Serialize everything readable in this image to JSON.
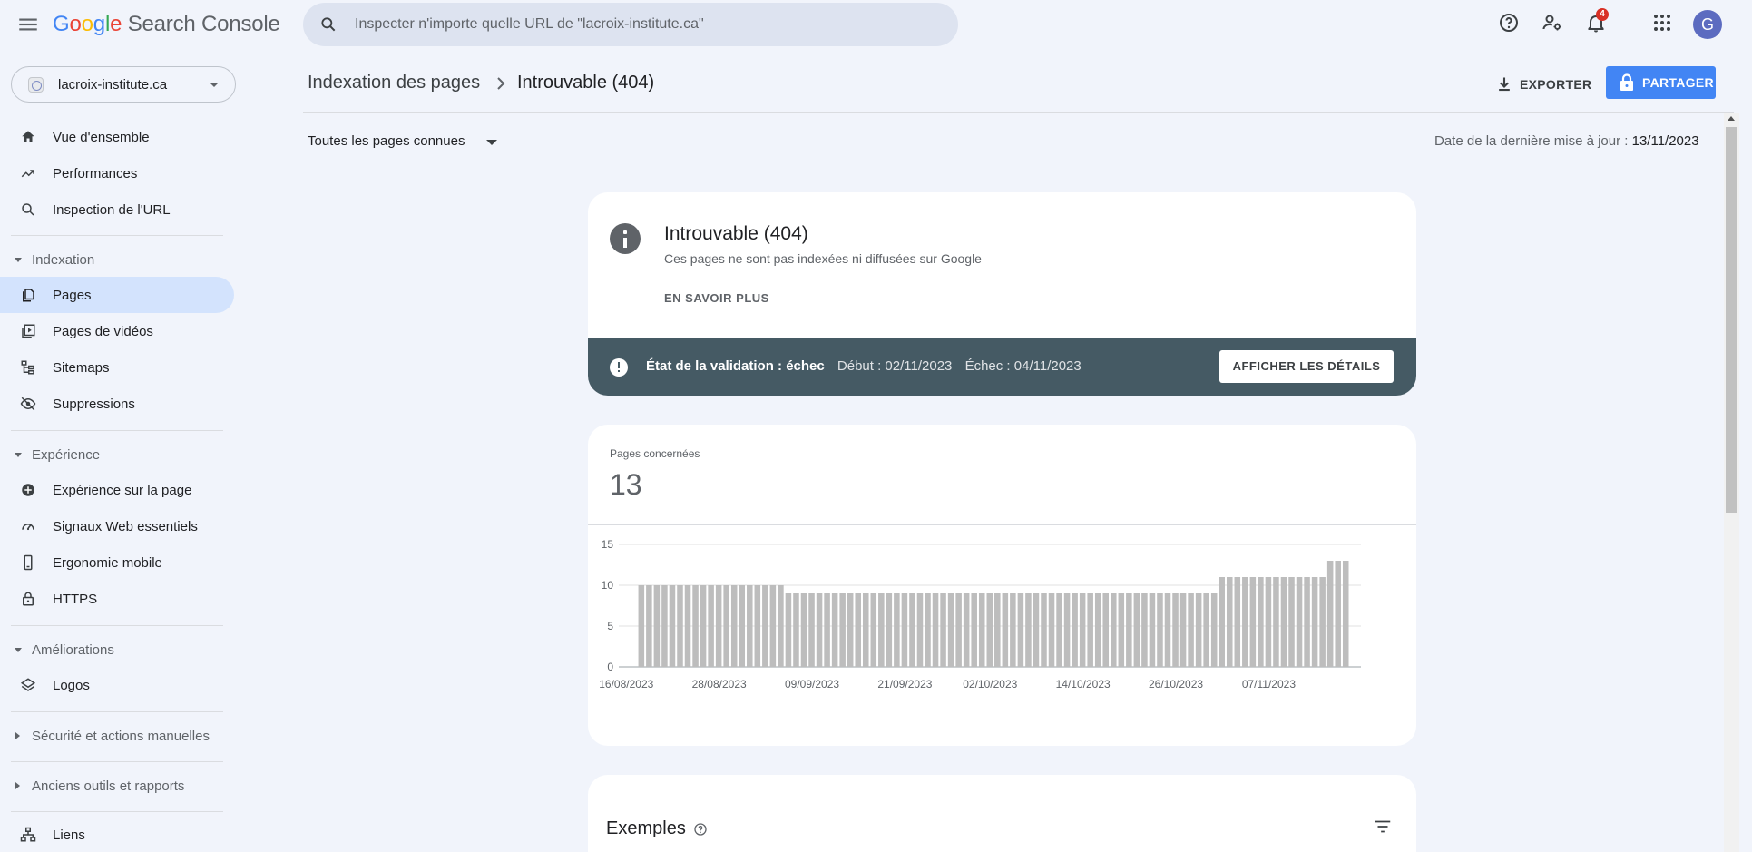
{
  "app": {
    "logo_google": [
      "G",
      "o",
      "o",
      "g",
      "l",
      "e"
    ],
    "logo_rest": "Search Console"
  },
  "search": {
    "placeholder": "Inspecter n'importe quelle URL de \"lacroix-institute.ca\""
  },
  "header": {
    "notification_count": "4",
    "avatar_letter": "G"
  },
  "property": {
    "label": "lacroix-institute.ca"
  },
  "sidebar": {
    "top_items": [
      {
        "label": "Vue d'ensemble",
        "icon": "home-icon"
      },
      {
        "label": "Performances",
        "icon": "trending-up-icon"
      },
      {
        "label": "Inspection de l'URL",
        "icon": "search-icon"
      }
    ],
    "sections": [
      {
        "label": "Indexation",
        "expanded": true,
        "items": [
          {
            "label": "Pages",
            "icon": "pages-icon",
            "active": true
          },
          {
            "label": "Pages de vidéos",
            "icon": "video-pages-icon"
          },
          {
            "label": "Sitemaps",
            "icon": "sitemap-icon"
          },
          {
            "label": "Suppressions",
            "icon": "eye-off-icon"
          }
        ]
      },
      {
        "label": "Expérience",
        "expanded": true,
        "items": [
          {
            "label": "Expérience sur la page",
            "icon": "plus-circle-icon"
          },
          {
            "label": "Signaux Web essentiels",
            "icon": "speed-gauge-icon"
          },
          {
            "label": "Ergonomie mobile",
            "icon": "phone-icon"
          },
          {
            "label": "HTTPS",
            "icon": "lock-icon"
          }
        ]
      },
      {
        "label": "Améliorations",
        "expanded": true,
        "items": [
          {
            "label": "Logos",
            "icon": "layers-icon"
          }
        ]
      },
      {
        "label": "Sécurité et actions manuelles",
        "expanded": false,
        "items": []
      },
      {
        "label": "Anciens outils et rapports",
        "expanded": false,
        "items": []
      }
    ],
    "bottom_items": [
      {
        "label": "Liens",
        "icon": "links-icon"
      }
    ]
  },
  "breadcrumb": {
    "parent": "Indexation des pages",
    "current": "Introuvable (404)"
  },
  "toolbar": {
    "export_label": "EXPORTER",
    "share_label": "PARTAGER"
  },
  "filter": {
    "selected": "Toutes les pages connues"
  },
  "last_update": {
    "prefix": "Date de la dernière mise à jour :",
    "date": "13/11/2023"
  },
  "issue_card": {
    "title": "Introuvable (404)",
    "description": "Ces pages ne sont pas indexées ni diffusées sur Google",
    "learn_more": "EN SAVOIR PLUS",
    "validation_status": "État de la validation : échec",
    "start": "Début : 02/11/2023",
    "failed": "Échec : 04/11/2023",
    "details_button": "AFFICHER LES DÉTAILS"
  },
  "kpi": {
    "label": "Pages concernées",
    "value": "13"
  },
  "chart_data": {
    "type": "bar",
    "ylim": [
      0,
      15
    ],
    "yticks": [
      0,
      5,
      10,
      15
    ],
    "xtick_labels": [
      "16/08/2023",
      "28/08/2023",
      "09/09/2023",
      "21/09/2023",
      "02/10/2023",
      "14/10/2023",
      "26/10/2023",
      "07/11/2023"
    ],
    "start_date": "16/08/2023",
    "end_date": "13/11/2023",
    "values": [
      0,
      0,
      10,
      10,
      10,
      10,
      10,
      10,
      10,
      10,
      10,
      10,
      10,
      10,
      10,
      10,
      10,
      10,
      10,
      10,
      10,
      9,
      9,
      9,
      9,
      9,
      9,
      9,
      9,
      9,
      9,
      9,
      9,
      9,
      9,
      9,
      9,
      9,
      9,
      9,
      9,
      9,
      9,
      9,
      9,
      9,
      9,
      9,
      9,
      9,
      9,
      9,
      9,
      9,
      9,
      9,
      9,
      9,
      9,
      9,
      9,
      9,
      9,
      9,
      9,
      9,
      9,
      9,
      9,
      9,
      9,
      9,
      9,
      9,
      9,
      9,
      9,
      11,
      11,
      11,
      11,
      11,
      11,
      11,
      11,
      11,
      11,
      11,
      11,
      11,
      11,
      13,
      13,
      13
    ],
    "bar_color": "#bdbdbd"
  },
  "examples": {
    "title": "Exemples"
  }
}
